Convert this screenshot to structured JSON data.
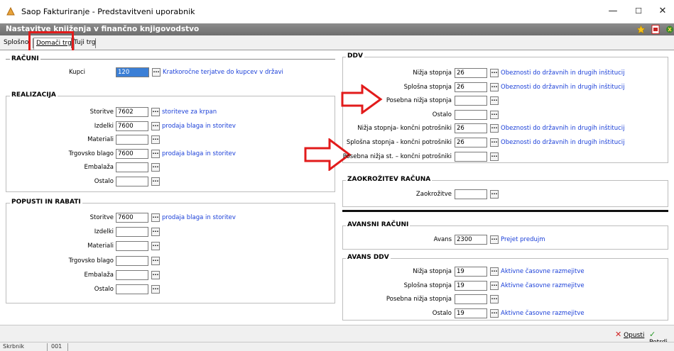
{
  "window": {
    "title": "Saop Fakturiranje - Predstavitveni uporabnik",
    "header": "Nastavitve knjiženja v finančno knjigovodstvo",
    "controls": {
      "minimize": "—",
      "maximize": "☐",
      "close": "✕"
    }
  },
  "tabs": [
    {
      "label": "Splošno"
    },
    {
      "label": "Domači trg"
    },
    {
      "label": "Tuji trg"
    }
  ],
  "racuni": {
    "title": "RAČUNI",
    "kupci": {
      "label": "Kupci",
      "value": "120",
      "desc": "Kratkoročne terjatve do kupcev v državi"
    }
  },
  "realizacija": {
    "title": "REALIZACIJA",
    "rows": [
      {
        "label": "Storitve",
        "value": "7602",
        "desc": "storiteve za krpan"
      },
      {
        "label": "Izdelki",
        "value": "7600",
        "desc": "prodaja blaga in storitev"
      },
      {
        "label": "Materiali",
        "value": "",
        "desc": ""
      },
      {
        "label": "Trgovsko blago",
        "value": "7600",
        "desc": "prodaja blaga in storitev"
      },
      {
        "label": "Embalaža",
        "value": "",
        "desc": ""
      },
      {
        "label": "Ostalo",
        "value": "",
        "desc": ""
      }
    ]
  },
  "popusti": {
    "title": "POPUSTI IN RABATI",
    "rows": [
      {
        "label": "Storitve",
        "value": "7600",
        "desc": "prodaja blaga in storitev"
      },
      {
        "label": "Izdelki",
        "value": "",
        "desc": ""
      },
      {
        "label": "Materiali",
        "value": "",
        "desc": ""
      },
      {
        "label": "Trgovsko blago",
        "value": "",
        "desc": ""
      },
      {
        "label": "Embalaža",
        "value": "",
        "desc": ""
      },
      {
        "label": "Ostalo",
        "value": "",
        "desc": ""
      }
    ]
  },
  "ddv": {
    "title": "DDV",
    "rows": [
      {
        "label": "Nižja stopnja",
        "value": "26",
        "desc": "Obeznosti do državnih in drugih inštitucij"
      },
      {
        "label": "Splošna stopnja",
        "value": "26",
        "desc": "Obeznosti do državnih in drugih inštitucij"
      },
      {
        "label": "Posebna nižja stopnja",
        "value": "",
        "desc": ""
      },
      {
        "label": "Ostalo",
        "value": "",
        "desc": ""
      },
      {
        "label": "Nižja stopnja- končni potrošniki",
        "value": "26",
        "desc": "Obeznosti do državnih in drugih inštitucij"
      },
      {
        "label": "Splošna stopnja - končni potrošniki",
        "value": "26",
        "desc": "Obeznosti do državnih in drugih inštitucij"
      },
      {
        "label": "Posebna nižja st. – končni potrošniki",
        "value": "",
        "desc": ""
      }
    ]
  },
  "zaokrozitev": {
    "title": "ZAOKROŽITEV RAČUNA",
    "row": {
      "label": "Zaokrožitve",
      "value": ""
    }
  },
  "avansni": {
    "title": "AVANSNI RAČUNI",
    "row": {
      "label": "Avans",
      "value": "2300",
      "desc": "Prejet predujm"
    }
  },
  "avans_ddv": {
    "title": "AVANS DDV",
    "rows": [
      {
        "label": "Nižja stopnja",
        "value": "19",
        "desc": "Aktivne časovne razmejitve"
      },
      {
        "label": "Splošna stopnja",
        "value": "19",
        "desc": "Aktivne časovne razmejitve"
      },
      {
        "label": "Posebna nižja stopnja",
        "value": "",
        "desc": ""
      },
      {
        "label": "Ostalo",
        "value": "19",
        "desc": "Aktivne časovne razmejitve"
      }
    ]
  },
  "actions": {
    "cancel": "Opusti",
    "confirm": "Potrdi"
  },
  "status": {
    "role": "Skrbnik",
    "code": "001"
  },
  "colors": {
    "link": "#1a3fd8",
    "highlight": "#e21b1b",
    "header": "#7a7a7a"
  }
}
